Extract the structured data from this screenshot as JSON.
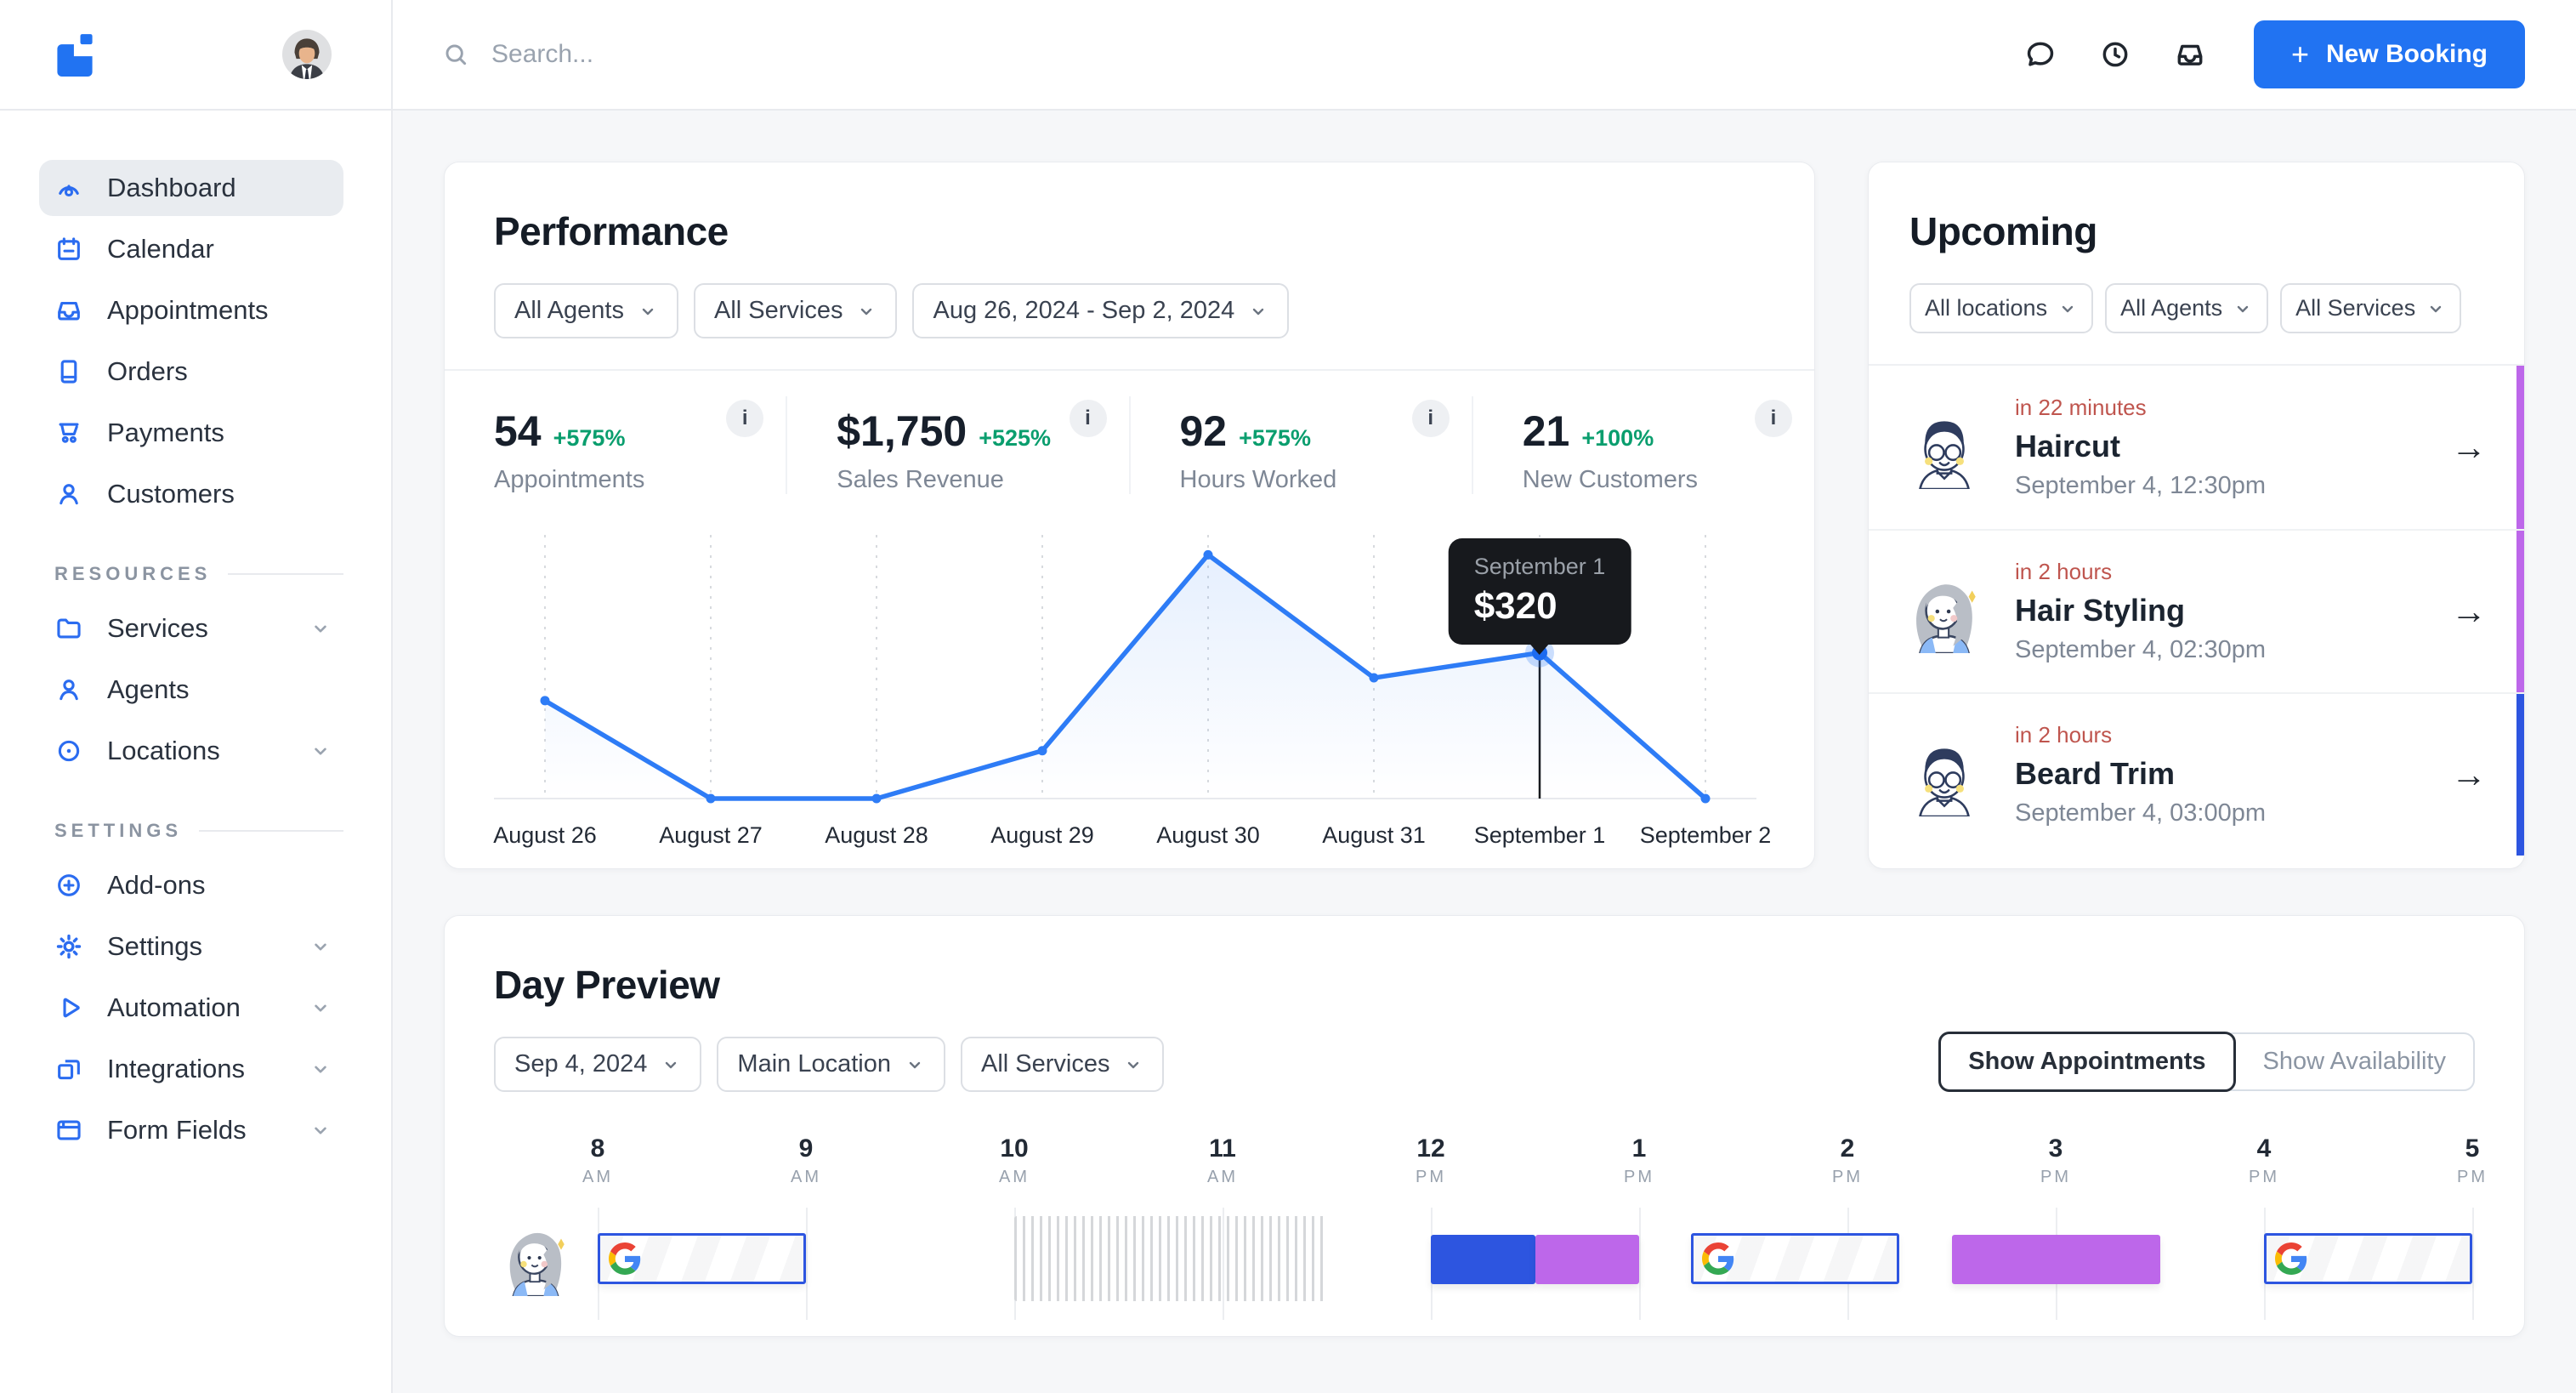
{
  "topbar": {
    "search_placeholder": "Search...",
    "new_booking_label": "New Booking"
  },
  "icons": {
    "info": "i",
    "arrow": "→",
    "plus": "+"
  },
  "sidebar": {
    "primary": [
      {
        "label": "Dashboard"
      },
      {
        "label": "Calendar"
      },
      {
        "label": "Appointments"
      },
      {
        "label": "Orders"
      },
      {
        "label": "Payments"
      },
      {
        "label": "Customers"
      }
    ],
    "resources_label": "RESOURCES",
    "resources": [
      {
        "label": "Services",
        "chevron": true
      },
      {
        "label": "Agents",
        "chevron": false
      },
      {
        "label": "Locations",
        "chevron": true
      }
    ],
    "settings_label": "SETTINGS",
    "settings": [
      {
        "label": "Add-ons",
        "chevron": false
      },
      {
        "label": "Settings",
        "chevron": true
      },
      {
        "label": "Automation",
        "chevron": true
      },
      {
        "label": "Integrations",
        "chevron": true
      },
      {
        "label": "Form Fields",
        "chevron": true
      }
    ]
  },
  "performance": {
    "title": "Performance",
    "filters": [
      {
        "label": "All Agents"
      },
      {
        "label": "All Services"
      },
      {
        "label": "Aug 26, 2024 - Sep 2, 2024"
      }
    ],
    "stats": [
      {
        "value": "54",
        "delta": "+575%",
        "label": "Appointments"
      },
      {
        "value": "$1,750",
        "delta": "+525%",
        "label": "Sales Revenue"
      },
      {
        "value": "92",
        "delta": "+575%",
        "label": "Hours Worked"
      },
      {
        "value": "21",
        "delta": "+100%",
        "label": "New Customers"
      }
    ]
  },
  "chart_data": {
    "type": "line",
    "title": "Performance (Sales Revenue by day)",
    "x": [
      "August 26",
      "August 27",
      "August 28",
      "August 29",
      "August 30",
      "August 31",
      "September 1",
      "September 2"
    ],
    "series": [
      {
        "name": "Sales Revenue",
        "values": [
          215,
          0,
          0,
          105,
          535,
          265,
          320,
          0
        ]
      }
    ],
    "ylim": [
      0,
      560
    ],
    "grid": "vertical-dashed",
    "legend": "none",
    "line_color": "#2e7cf6",
    "tooltip": {
      "label": "September 1",
      "value": "$320",
      "index": 6
    }
  },
  "upcoming": {
    "title": "Upcoming",
    "filters": [
      {
        "label": "All locations"
      },
      {
        "label": "All Agents"
      },
      {
        "label": "All Services"
      }
    ],
    "items": [
      {
        "time_until": "in 22 minutes",
        "service": "Haircut",
        "datetime": "September 4, 12:30pm",
        "accent": "#bd67ea",
        "avatar": "man"
      },
      {
        "time_until": "in 2 hours",
        "service": "Hair Styling",
        "datetime": "September 4, 02:30pm",
        "accent": "#bd67ea",
        "avatar": "woman"
      },
      {
        "time_until": "in 2 hours",
        "service": "Beard Trim",
        "datetime": "September 4, 03:00pm",
        "accent": "#2d55e0",
        "avatar": "man"
      }
    ]
  },
  "day_preview": {
    "title": "Day Preview",
    "filters": [
      {
        "label": "Sep 4, 2024"
      },
      {
        "label": "Main Location"
      },
      {
        "label": "All Services"
      }
    ],
    "toggle": [
      {
        "label": "Show Appointments",
        "active": true
      },
      {
        "label": "Show Availability",
        "active": false
      }
    ],
    "hours": [
      {
        "label": "8",
        "meridiem": "AM"
      },
      {
        "label": "9",
        "meridiem": "AM"
      },
      {
        "label": "10",
        "meridiem": "AM"
      },
      {
        "label": "11",
        "meridiem": "AM"
      },
      {
        "label": "12",
        "meridiem": "PM"
      },
      {
        "label": "1",
        "meridiem": "PM"
      },
      {
        "label": "2",
        "meridiem": "PM"
      },
      {
        "label": "3",
        "meridiem": "PM"
      },
      {
        "label": "4",
        "meridiem": "PM"
      },
      {
        "label": "5",
        "meridiem": "PM"
      }
    ],
    "events": [
      {
        "kind": "google_synced",
        "start": 8,
        "end": 9
      },
      {
        "kind": "blocked",
        "start": 10,
        "end": 11.5
      },
      {
        "kind": "booking",
        "color": "#2d55e0",
        "start": 12,
        "end": 12.5
      },
      {
        "kind": "booking",
        "color": "#bd67ea",
        "start": 12.5,
        "end": 13
      },
      {
        "kind": "google_synced",
        "start": 13.25,
        "end": 14.25
      },
      {
        "kind": "booking",
        "color": "#bd67ea",
        "start": 14.5,
        "end": 15.5
      },
      {
        "kind": "google_synced",
        "start": 16,
        "end": 17
      }
    ]
  },
  "colors": {
    "accent": "#2173f2",
    "green": "#0a9e6e",
    "red": "#bf554e",
    "purple": "#bd67ea",
    "event_blue": "#2d55e0",
    "chart_line": "#2e7cf6"
  }
}
